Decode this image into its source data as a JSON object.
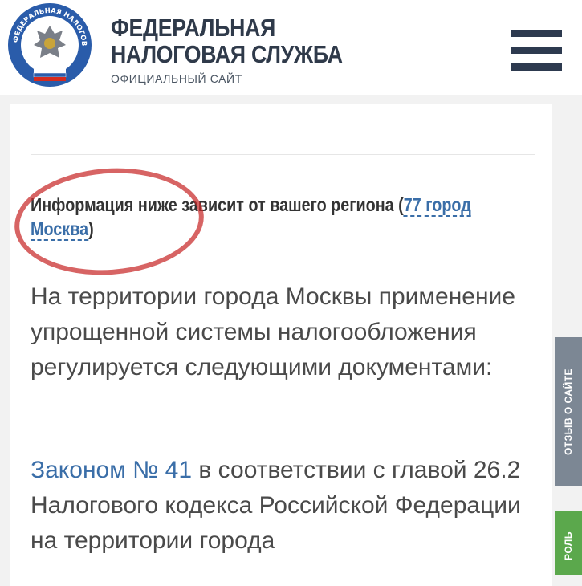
{
  "header": {
    "logo_ring_text": "ФЕДЕРАЛЬНАЯ НАЛОГОВАЯ СЛУЖБА",
    "title_line1": "ФЕДЕРАЛЬНАЯ",
    "title_line2": "НАЛОГОВАЯ СЛУЖБА",
    "subtitle": "ОФИЦИАЛЬНЫЙ САЙТ",
    "menu_icon": "hamburger-menu-icon"
  },
  "main": {
    "region_notice_prefix": "Информация ниже зависит от вашего региона (",
    "region_link": "77 город Москва",
    "region_notice_suffix": ")",
    "paragraph1": "На территории города Москвы применение упрощенной системы налогообложения регулируется следующими документами:",
    "law_link": "Законом № 41",
    "law_text": " в соответствии с главой 26.2 Налогового кодекса Российской Федерации на территории города"
  },
  "side_tabs": {
    "feedback": "ОТЗЫВ О САЙТЕ",
    "green_tab": "РОЛЬ"
  },
  "colors": {
    "brand_dark": "#2d3a4f",
    "link": "#3a6ea8",
    "annotation_circle": "#c82828",
    "feedback_tab": "#7c8794",
    "green_tab": "#5ba84c"
  }
}
